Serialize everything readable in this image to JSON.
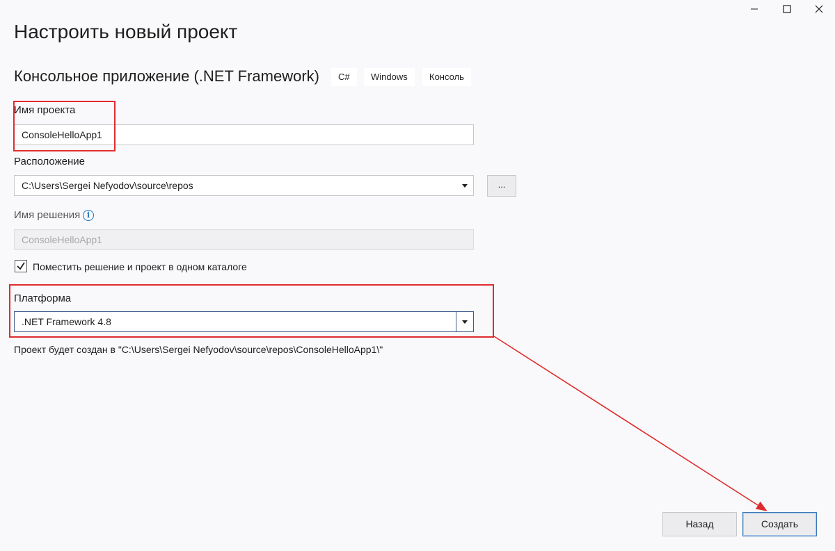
{
  "window": {
    "minimize_icon": "minimize-icon",
    "maximize_icon": "maximize-icon",
    "close_icon": "close-icon"
  },
  "page_title": "Настроить новый проект",
  "template": {
    "name": "Консольное приложение (.NET Framework)",
    "tags": [
      "C#",
      "Windows",
      "Консоль"
    ]
  },
  "project_name": {
    "label": "Имя проекта",
    "value": "ConsoleHelloApp1"
  },
  "location": {
    "label": "Расположение",
    "value": "C:\\Users\\Sergei Nefyodov\\source\\repos",
    "browse_label": "..."
  },
  "solution_name": {
    "label": "Имя решения",
    "value": "ConsoleHelloApp1",
    "info_icon": "info-icon"
  },
  "same_directory": {
    "label": "Поместить решение и проект в одном каталоге",
    "checked": true
  },
  "platform": {
    "label": "Платформа",
    "value": ".NET Framework 4.8"
  },
  "summary": "Проект будет создан в \"C:\\Users\\Sergei Nefyodov\\source\\repos\\ConsoleHelloApp1\\\"",
  "buttons": {
    "back": "Назад",
    "create": "Создать"
  },
  "colors": {
    "background": "#f9f9fb",
    "annotation": "#e02c2c",
    "accent": "#3b79b9",
    "info": "#1a73c9"
  }
}
